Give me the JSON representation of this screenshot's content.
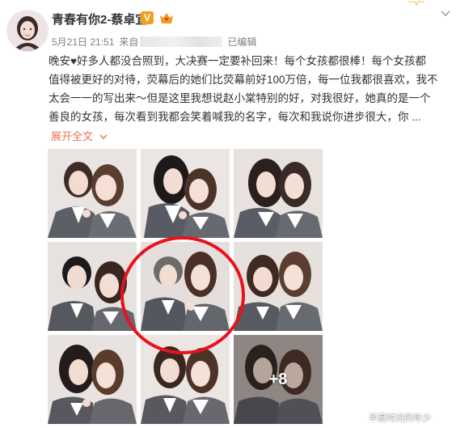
{
  "post": {
    "author": "青春有你2-蔡卓宜",
    "vip_badge": "V",
    "verified_icon": "crown-heart-icon",
    "date": "5月21日 21:51",
    "source_prefix": "来自",
    "edited_label": "已编辑",
    "text_lines": [
      "晚安♥好多人都没合照到，大决赛一定要补回来！每个女孩都很棒！每个女孩都",
      "值得被更好的对待，荧幕后的她们比荧幕前好100万倍，每一位我都很喜欢，我不",
      "太会一一的写出来～但是这里我想说赵小棠特别的好，对我很好，她真的是一个",
      "善良的女孩，每次看到我都会笑着喊我的名字，每次和我说你进步很大，你 ..."
    ],
    "expand_label": "展开全文",
    "more_photos_label": "+8",
    "accent_color": "#eb7350",
    "highlight_color": "#e8121e"
  },
  "photos": [
    {
      "name": "photo-1",
      "description_icon": "photo-thumbnail"
    },
    {
      "name": "photo-2",
      "description_icon": "photo-thumbnail"
    },
    {
      "name": "photo-3",
      "description_icon": "photo-thumbnail"
    },
    {
      "name": "photo-4",
      "description_icon": "photo-thumbnail"
    },
    {
      "name": "photo-5",
      "description_icon": "photo-thumbnail"
    },
    {
      "name": "photo-6",
      "description_icon": "photo-thumbnail"
    },
    {
      "name": "photo-7",
      "description_icon": "photo-thumbnail"
    },
    {
      "name": "photo-8",
      "description_icon": "photo-thumbnail"
    },
    {
      "name": "photo-9",
      "description_icon": "photo-thumbnail"
    }
  ],
  "watermark": "半夏时光的年少"
}
